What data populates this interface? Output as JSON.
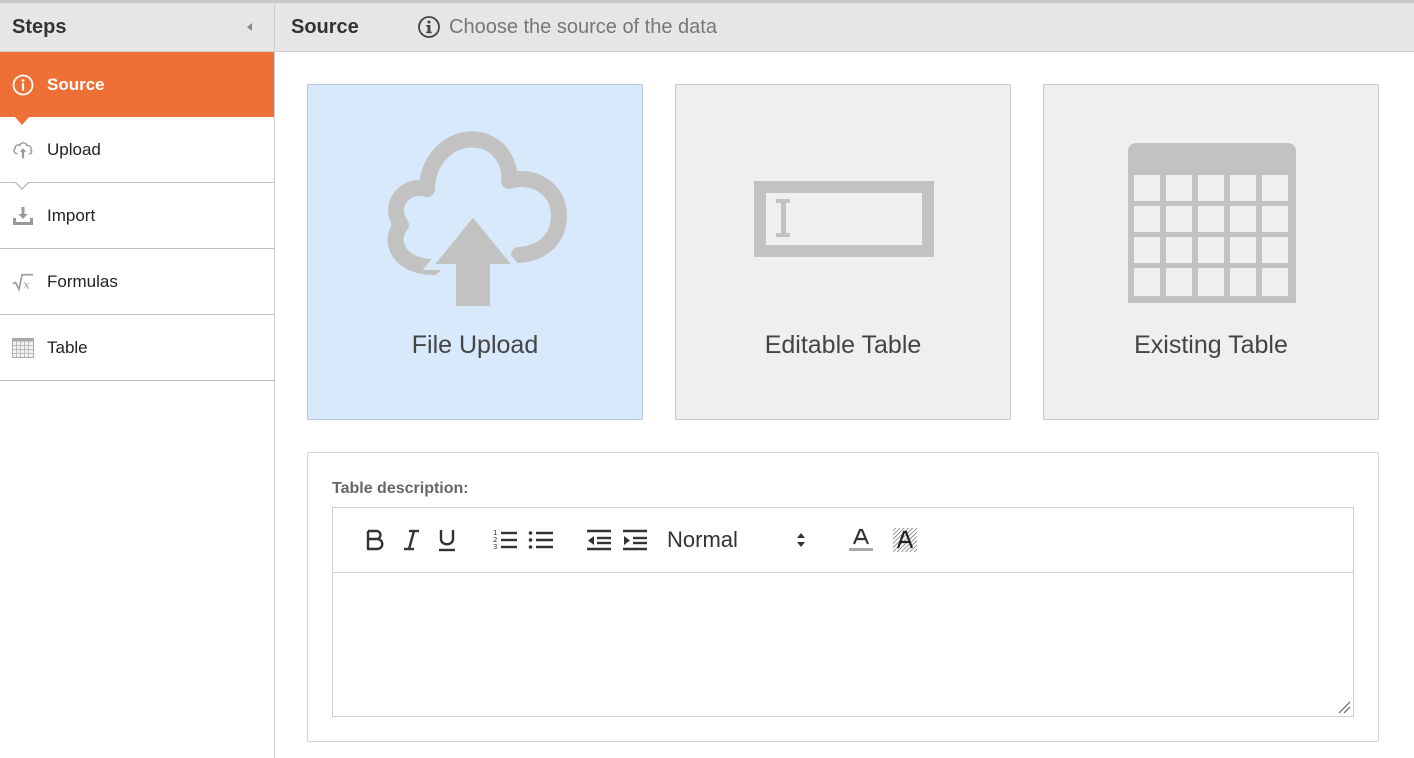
{
  "sidebar": {
    "title": "Steps",
    "items": [
      {
        "label": "Source",
        "icon": "info-icon",
        "active": true
      },
      {
        "label": "Upload",
        "icon": "cloud-upload-icon"
      },
      {
        "label": "Import",
        "icon": "download-tray-icon"
      },
      {
        "label": "Formulas",
        "icon": "sqrt-x-icon"
      },
      {
        "label": "Table",
        "icon": "grid-table-icon"
      }
    ]
  },
  "header": {
    "title": "Source",
    "hint": "Choose the source of the data"
  },
  "sources": [
    {
      "label": "File Upload",
      "icon": "cloud-upload-icon",
      "selected": true
    },
    {
      "label": "Editable Table",
      "icon": "text-field-icon",
      "selected": false
    },
    {
      "label": "Existing Table",
      "icon": "table-icon",
      "selected": false
    }
  ],
  "description": {
    "label": "Table description:",
    "format_value": "Normal",
    "content": ""
  },
  "colors": {
    "accent": "#ee7036",
    "selected_card": "#d8e9fc",
    "card": "#efefef",
    "header": "#e6e6e6",
    "icon_gray": "#bdbdbd"
  }
}
